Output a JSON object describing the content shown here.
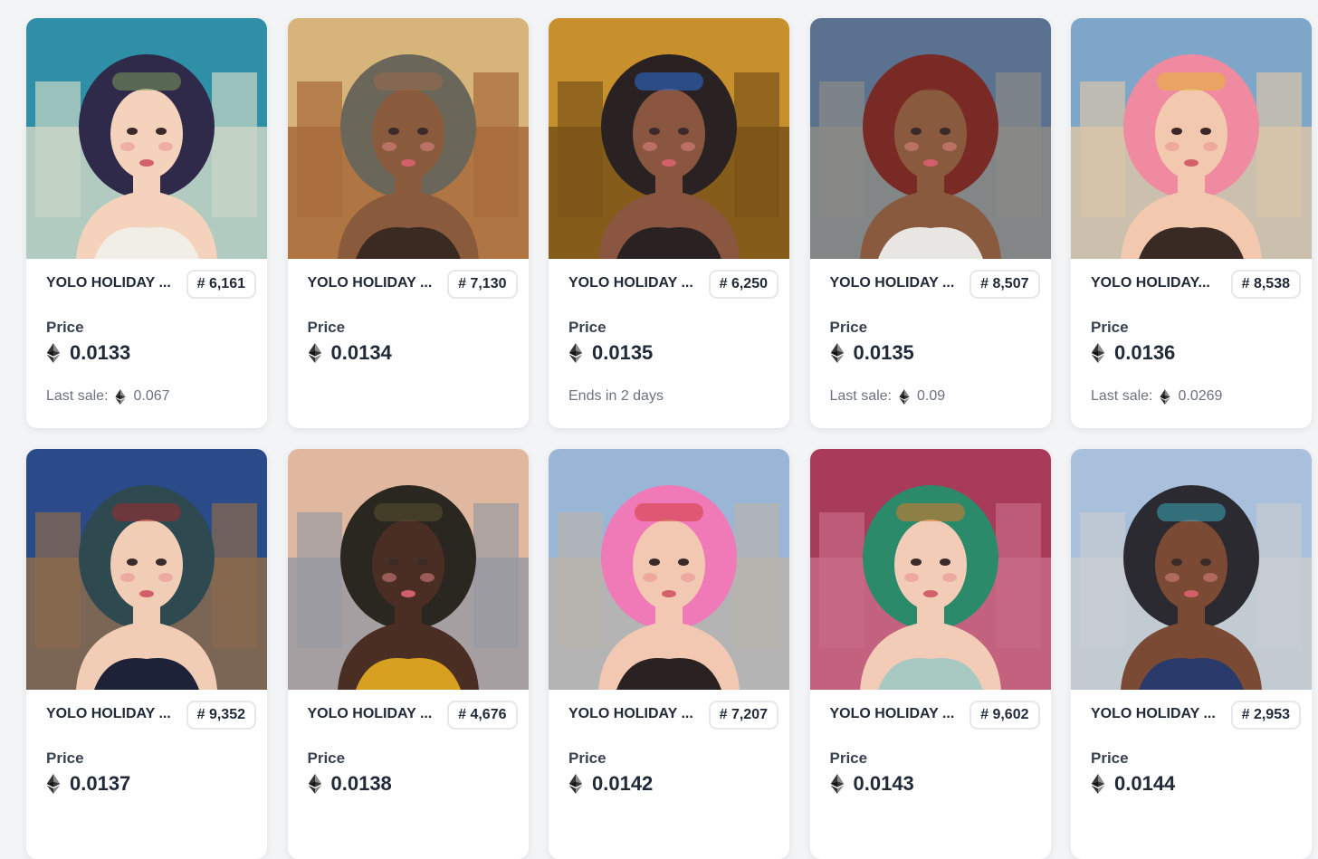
{
  "price_label": "Price",
  "last_sale_label": "Last sale:",
  "cards": [
    {
      "name": "YOLO HOLIDAY ...",
      "token": "# 6,161",
      "price": "0.0133",
      "sub_type": "last_sale",
      "sub": "0.067",
      "colors": {
        "sky": "#2e8fa6",
        "bg2": "#c9d6c6",
        "hair": "#2f2a4a",
        "skin": "#f4d2bc",
        "top": "#f1eee6",
        "accent": "#7a9a5a"
      }
    },
    {
      "name": "YOLO HOLIDAY ...",
      "token": "# 7,130",
      "price": "0.0134",
      "sub_type": "none",
      "sub": "",
      "colors": {
        "sky": "#d6b47a",
        "bg2": "#a86a3a",
        "hair": "#6b665a",
        "skin": "#8a5a3c",
        "top": "#3a2a22",
        "accent": "#9a6a4a"
      }
    },
    {
      "name": "YOLO HOLIDAY ...",
      "token": "# 6,250",
      "price": "0.0135",
      "sub_type": "ends",
      "sub": "Ends in 2 days",
      "colors": {
        "sky": "#c8902c",
        "bg2": "#7a5418",
        "hair": "#2a2222",
        "skin": "#8a5640",
        "top": "#2a2222",
        "accent": "#2b6fd6"
      }
    },
    {
      "name": "YOLO HOLIDAY ...",
      "token": "# 8,507",
      "price": "0.0135",
      "sub_type": "last_sale",
      "sub": "0.09",
      "colors": {
        "sky": "#5a7290",
        "bg2": "#8a8a86",
        "hair": "#7a2a24",
        "skin": "#8a5a3e",
        "top": "#e8e6e2",
        "accent": "#7a2a24"
      }
    },
    {
      "name": "YOLO HOLIDAY...",
      "token": "# 8,538",
      "price": "0.0136",
      "sub_type": "last_sale",
      "sub": "0.0269",
      "colors": {
        "sky": "#7ea6c8",
        "bg2": "#d8c4a8",
        "hair": "#f08aa0",
        "skin": "#f2c8ae",
        "top": "#3a2a24",
        "accent": "#e6b830"
      }
    },
    {
      "name": "YOLO HOLIDAY ...",
      "token": "# 9,352",
      "price": "0.0137",
      "sub_type": "none",
      "sub": "",
      "colors": {
        "sky": "#2a4a8a",
        "bg2": "#8a6a4a",
        "hair": "#2e4a50",
        "skin": "#f2cdb6",
        "top": "#1e2238",
        "accent": "#a02a2a"
      }
    },
    {
      "name": "YOLO HOLIDAY ...",
      "token": "# 4,676",
      "price": "0.0138",
      "sub_type": "none",
      "sub": "",
      "colors": {
        "sky": "#e0b8a0",
        "bg2": "#9a9aa2",
        "hair": "#2a2620",
        "skin": "#4a2e24",
        "top": "#d8a020",
        "accent": "#5a5030"
      }
    },
    {
      "name": "YOLO HOLIDAY ...",
      "token": "# 7,207",
      "price": "0.0142",
      "sub_type": "none",
      "sub": "",
      "colors": {
        "sky": "#9ab6d6",
        "bg2": "#b8b4ae",
        "hair": "#f07ab8",
        "skin": "#f2c8b2",
        "top": "#2a2222",
        "accent": "#d23a3a"
      }
    },
    {
      "name": "YOLO HOLIDAY ...",
      "token": "# 9,602",
      "price": "0.0143",
      "sub_type": "none",
      "sub": "",
      "colors": {
        "sky": "#a83a5a",
        "bg2": "#c86a86",
        "hair": "#2a8a6a",
        "skin": "#f2ccb6",
        "top": "#a8c8c2",
        "accent": "#e0762a"
      }
    },
    {
      "name": "YOLO HOLIDAY ...",
      "token": "# 2,953",
      "price": "0.0144",
      "sub_type": "none",
      "sub": "",
      "colors": {
        "sky": "#a8c0dc",
        "bg2": "#c8ccd0",
        "hair": "#2a2a30",
        "skin": "#7a4a34",
        "top": "#2a3a6a",
        "accent": "#3aa8b8"
      }
    }
  ]
}
